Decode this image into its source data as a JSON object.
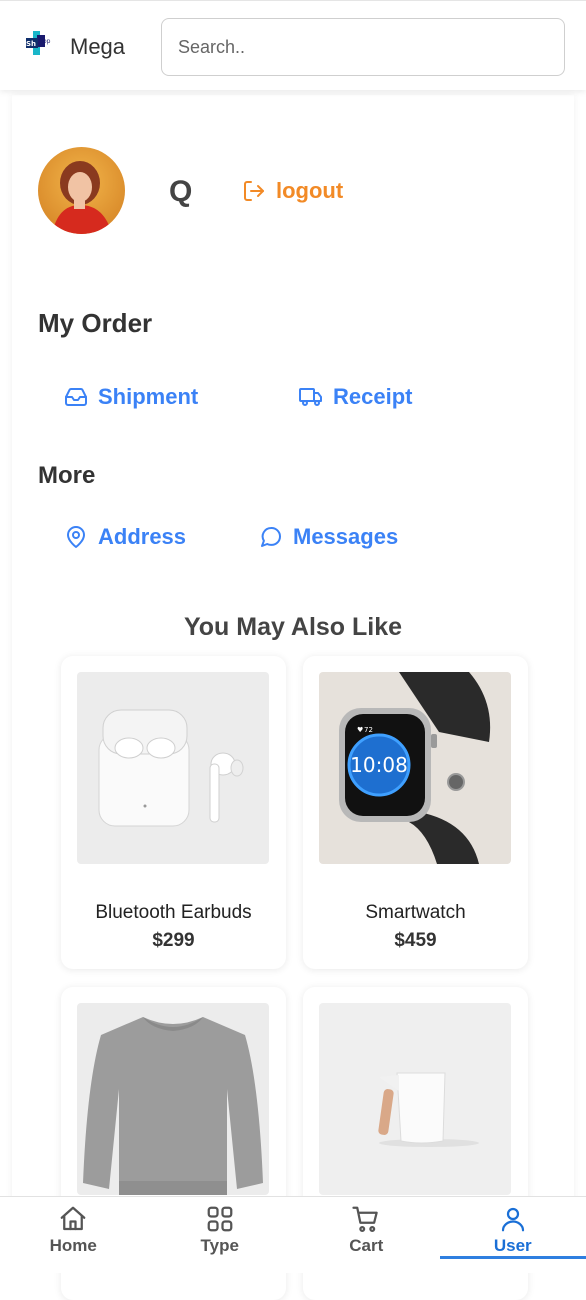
{
  "header": {
    "brand": "Mega",
    "search_placeholder": "Search.."
  },
  "profile": {
    "username": "Q",
    "logout_label": "logout"
  },
  "my_order": {
    "title": "My Order",
    "items": [
      {
        "label": "Shipment",
        "icon": "inbox-icon"
      },
      {
        "label": "Receipt",
        "icon": "truck-icon"
      }
    ]
  },
  "more": {
    "title": "More",
    "items": [
      {
        "label": "Address",
        "icon": "map-pin-icon"
      },
      {
        "label": "Messages",
        "icon": "chat-bubble-icon"
      }
    ]
  },
  "recommendations": {
    "title": "You May Also Like",
    "products": [
      {
        "name": "Bluetooth Earbuds",
        "price": "$299"
      },
      {
        "name": "Smartwatch",
        "price": "$459"
      },
      {
        "name": "",
        "price": ""
      },
      {
        "name": "",
        "price": ""
      }
    ],
    "watch_time": "10:08",
    "watch_heart": "72"
  },
  "bottom_nav": {
    "items": [
      {
        "label": "Home",
        "icon": "home-icon"
      },
      {
        "label": "Type",
        "icon": "grid-icon"
      },
      {
        "label": "Cart",
        "icon": "cart-icon"
      },
      {
        "label": "User",
        "icon": "user-icon",
        "active": true
      }
    ]
  },
  "colors": {
    "accent_blue": "#3b82f6",
    "logout_orange": "#f28a26",
    "active_nav": "#1a6fd6"
  }
}
